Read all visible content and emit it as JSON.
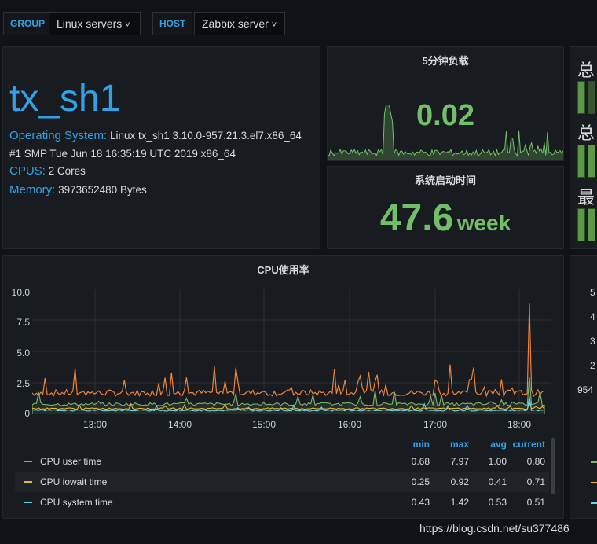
{
  "variables": {
    "group_label": "GROUP",
    "group_value": "Linux servers",
    "host_label": "HOST",
    "host_value": "Zabbix server",
    "chevron": "˅"
  },
  "info": {
    "hostname": "tx_sh1",
    "os_label": "Operating System:",
    "os_value": "Linux tx_sh1 3.10.0-957.21.3.el7.x86_64",
    "os_line2": "#1 SMP Tue Jun 18 16:35:19 UTC 2019 x86_64",
    "cpus_label": "CPUS:",
    "cpus_value": "2 Cores",
    "memory_label": "Memory:",
    "memory_value": "3973652480 Bytes"
  },
  "load": {
    "title": "5分钟负载",
    "value": "0.02"
  },
  "uptime": {
    "title": "系统启动时间",
    "value": "47.6",
    "unit": "week"
  },
  "right_partial": {
    "lines": [
      "总",
      "总",
      "最"
    ],
    "y_ticks": [
      "5",
      "4",
      "3",
      "2",
      "954"
    ]
  },
  "colors": {
    "user": "#7eb26d",
    "iowait": "#eab839",
    "system": "#6ed0e0",
    "load": "#73bf69",
    "peak": "#ef843c",
    "accent": "#33a2e5"
  },
  "chart_data": {
    "type": "line",
    "title": "CPU使用率",
    "ylim": [
      0,
      10
    ],
    "y_ticks": [
      "10.0",
      "7.5",
      "5.0",
      "2.5",
      "0"
    ],
    "x_ticks": [
      "13:00",
      "14:00",
      "15:00",
      "16:00",
      "17:00",
      "18:00"
    ],
    "grid": true,
    "legend_position": "bottom",
    "legend_headers": [
      "min",
      "max",
      "avg",
      "current"
    ],
    "series": [
      {
        "name": "CPU user time",
        "color": "#7eb26d",
        "min": "0.68",
        "max": "7.97",
        "avg": "1.00",
        "current": "0.80"
      },
      {
        "name": "CPU iowait time",
        "color": "#eab839",
        "min": "0.25",
        "max": "0.92",
        "avg": "0.41",
        "current": "0.71"
      },
      {
        "name": "CPU system time",
        "color": "#6ed0e0",
        "min": "0.43",
        "max": "1.42",
        "avg": "0.53",
        "current": "0.51"
      }
    ]
  },
  "watermark": "https://blog.csdn.net/su377486"
}
